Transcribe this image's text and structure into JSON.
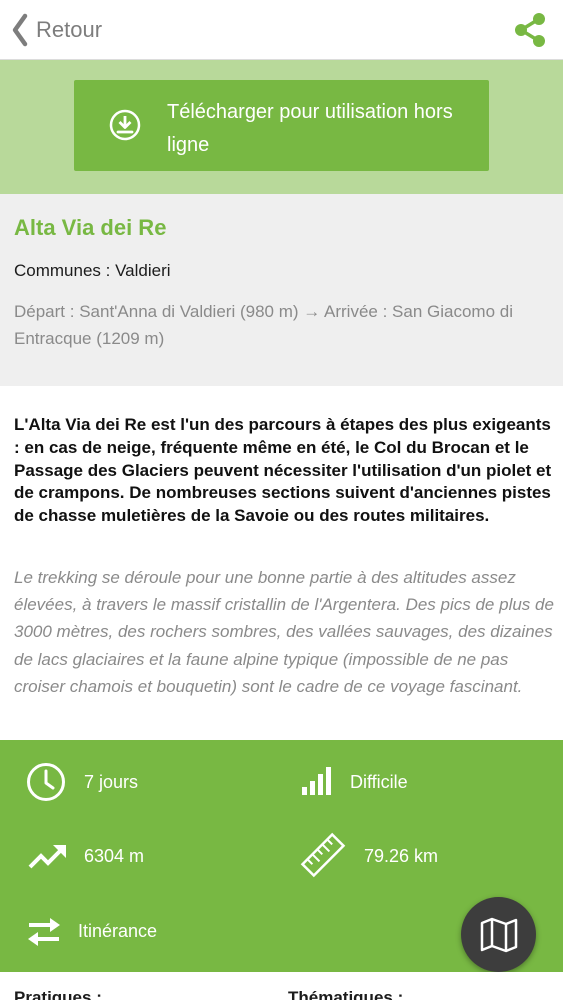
{
  "header": {
    "back_label": "Retour",
    "back_icon": "chevron-left-icon",
    "share_icon": "share-icon"
  },
  "download": {
    "label": "Télécharger pour utilisation hors ligne",
    "icon": "download-icon"
  },
  "trail": {
    "title": "Alta Via dei Re",
    "communes": "Communes : Valdieri",
    "route": "Départ : Sant'Anna di Valdieri (980 m) → Arrivée : San Giacomo di Entracque (1209 m)"
  },
  "description": {
    "bold": "L'Alta Via dei Re est l'un des parcours à étapes des plus exigeants : en cas de neige, fréquente même en été, le Col du Brocan et le Passage des Glaciers peuvent nécessiter l'utilisation d'un piolet et de crampons. De nombreuses sections suivent d'anciennes pistes de chasse muletières de la Savoie ou des routes militaires.",
    "italic": "Le trekking se déroule pour une bonne partie à des altitudes assez élevées, à travers le massif cristallin de l'Argentera. Des pics de plus de 3000 mètres, des rochers sombres, des vallées sauvages, des dizaines de lacs glaciaires et la faune alpine typique (impossible de ne pas croiser chamois et bouquetin) sont le cadre de ce voyage fascinant."
  },
  "stats": {
    "duration": "7 jours",
    "difficulty": "Difficile",
    "elevation": "6304 m",
    "distance": "79.26 km",
    "type": "Itinérance"
  },
  "map_button": {
    "icon": "map-icon"
  },
  "sections": {
    "left": "Pratiques :",
    "right": "Thématiques :"
  },
  "colors": {
    "accent": "#78b843",
    "accent_light": "#b8d99a",
    "info_bg": "#efefef",
    "fab": "#3d3d3d"
  }
}
